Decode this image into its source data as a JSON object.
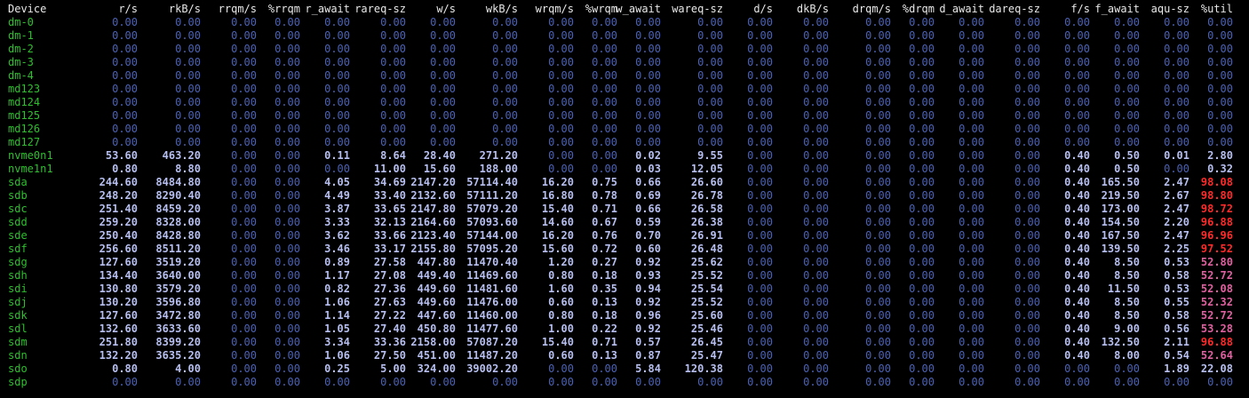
{
  "theme": {
    "background": "#000000",
    "header": "#e8e8e8",
    "device": "#2fbf2f",
    "zero_value": "#4c62b4",
    "nonzero_value": "#b7bff0",
    "util_high": "#ff2a2a",
    "util_mid": "#e060a0"
  },
  "headers": [
    "Device",
    "r/s",
    "rkB/s",
    "rrqm/s",
    "%rrqm",
    "r_await",
    "rareq-sz",
    "w/s",
    "wkB/s",
    "wrqm/s",
    "%wrqm",
    "w_await",
    "wareq-sz",
    "d/s",
    "dkB/s",
    "drqm/s",
    "%drqm",
    "d_await",
    "dareq-sz",
    "f/s",
    "f_await",
    "aqu-sz",
    "%util"
  ],
  "rows": [
    [
      "dm-0",
      "0.00",
      "0.00",
      "0.00",
      "0.00",
      "0.00",
      "0.00",
      "0.00",
      "0.00",
      "0.00",
      "0.00",
      "0.00",
      "0.00",
      "0.00",
      "0.00",
      "0.00",
      "0.00",
      "0.00",
      "0.00",
      "0.00",
      "0.00",
      "0.00",
      "0.00"
    ],
    [
      "dm-1",
      "0.00",
      "0.00",
      "0.00",
      "0.00",
      "0.00",
      "0.00",
      "0.00",
      "0.00",
      "0.00",
      "0.00",
      "0.00",
      "0.00",
      "0.00",
      "0.00",
      "0.00",
      "0.00",
      "0.00",
      "0.00",
      "0.00",
      "0.00",
      "0.00",
      "0.00"
    ],
    [
      "dm-2",
      "0.00",
      "0.00",
      "0.00",
      "0.00",
      "0.00",
      "0.00",
      "0.00",
      "0.00",
      "0.00",
      "0.00",
      "0.00",
      "0.00",
      "0.00",
      "0.00",
      "0.00",
      "0.00",
      "0.00",
      "0.00",
      "0.00",
      "0.00",
      "0.00",
      "0.00"
    ],
    [
      "dm-3",
      "0.00",
      "0.00",
      "0.00",
      "0.00",
      "0.00",
      "0.00",
      "0.00",
      "0.00",
      "0.00",
      "0.00",
      "0.00",
      "0.00",
      "0.00",
      "0.00",
      "0.00",
      "0.00",
      "0.00",
      "0.00",
      "0.00",
      "0.00",
      "0.00",
      "0.00"
    ],
    [
      "dm-4",
      "0.00",
      "0.00",
      "0.00",
      "0.00",
      "0.00",
      "0.00",
      "0.00",
      "0.00",
      "0.00",
      "0.00",
      "0.00",
      "0.00",
      "0.00",
      "0.00",
      "0.00",
      "0.00",
      "0.00",
      "0.00",
      "0.00",
      "0.00",
      "0.00",
      "0.00"
    ],
    [
      "md123",
      "0.00",
      "0.00",
      "0.00",
      "0.00",
      "0.00",
      "0.00",
      "0.00",
      "0.00",
      "0.00",
      "0.00",
      "0.00",
      "0.00",
      "0.00",
      "0.00",
      "0.00",
      "0.00",
      "0.00",
      "0.00",
      "0.00",
      "0.00",
      "0.00",
      "0.00"
    ],
    [
      "md124",
      "0.00",
      "0.00",
      "0.00",
      "0.00",
      "0.00",
      "0.00",
      "0.00",
      "0.00",
      "0.00",
      "0.00",
      "0.00",
      "0.00",
      "0.00",
      "0.00",
      "0.00",
      "0.00",
      "0.00",
      "0.00",
      "0.00",
      "0.00",
      "0.00",
      "0.00"
    ],
    [
      "md125",
      "0.00",
      "0.00",
      "0.00",
      "0.00",
      "0.00",
      "0.00",
      "0.00",
      "0.00",
      "0.00",
      "0.00",
      "0.00",
      "0.00",
      "0.00",
      "0.00",
      "0.00",
      "0.00",
      "0.00",
      "0.00",
      "0.00",
      "0.00",
      "0.00",
      "0.00"
    ],
    [
      "md126",
      "0.00",
      "0.00",
      "0.00",
      "0.00",
      "0.00",
      "0.00",
      "0.00",
      "0.00",
      "0.00",
      "0.00",
      "0.00",
      "0.00",
      "0.00",
      "0.00",
      "0.00",
      "0.00",
      "0.00",
      "0.00",
      "0.00",
      "0.00",
      "0.00",
      "0.00"
    ],
    [
      "md127",
      "0.00",
      "0.00",
      "0.00",
      "0.00",
      "0.00",
      "0.00",
      "0.00",
      "0.00",
      "0.00",
      "0.00",
      "0.00",
      "0.00",
      "0.00",
      "0.00",
      "0.00",
      "0.00",
      "0.00",
      "0.00",
      "0.00",
      "0.00",
      "0.00",
      "0.00"
    ],
    [
      "nvme0n1",
      "53.60",
      "463.20",
      "0.00",
      "0.00",
      "0.11",
      "8.64",
      "28.40",
      "271.20",
      "0.00",
      "0.00",
      "0.02",
      "9.55",
      "0.00",
      "0.00",
      "0.00",
      "0.00",
      "0.00",
      "0.00",
      "0.40",
      "0.50",
      "0.01",
      "2.80"
    ],
    [
      "nvme1n1",
      "0.80",
      "8.80",
      "0.00",
      "0.00",
      "0.00",
      "11.00",
      "15.60",
      "188.00",
      "0.00",
      "0.00",
      "0.03",
      "12.05",
      "0.00",
      "0.00",
      "0.00",
      "0.00",
      "0.00",
      "0.00",
      "0.40",
      "0.50",
      "0.00",
      "0.32"
    ],
    [
      "sda",
      "244.60",
      "8484.80",
      "0.00",
      "0.00",
      "4.05",
      "34.69",
      "2147.20",
      "57114.40",
      "16.20",
      "0.75",
      "0.66",
      "26.60",
      "0.00",
      "0.00",
      "0.00",
      "0.00",
      "0.00",
      "0.00",
      "0.40",
      "165.50",
      "2.47",
      "98.08"
    ],
    [
      "sdb",
      "248.20",
      "8290.40",
      "0.00",
      "0.00",
      "4.49",
      "33.40",
      "2132.60",
      "57111.20",
      "16.80",
      "0.78",
      "0.69",
      "26.78",
      "0.00",
      "0.00",
      "0.00",
      "0.00",
      "0.00",
      "0.00",
      "0.40",
      "219.50",
      "2.67",
      "98.80"
    ],
    [
      "sdc",
      "251.40",
      "8459.20",
      "0.00",
      "0.00",
      "3.87",
      "33.65",
      "2147.80",
      "57079.20",
      "15.40",
      "0.71",
      "0.66",
      "26.58",
      "0.00",
      "0.00",
      "0.00",
      "0.00",
      "0.00",
      "0.00",
      "0.40",
      "173.00",
      "2.47",
      "98.72"
    ],
    [
      "sdd",
      "259.20",
      "8328.00",
      "0.00",
      "0.00",
      "3.33",
      "32.13",
      "2164.60",
      "57093.60",
      "14.60",
      "0.67",
      "0.59",
      "26.38",
      "0.00",
      "0.00",
      "0.00",
      "0.00",
      "0.00",
      "0.00",
      "0.40",
      "154.50",
      "2.20",
      "96.88"
    ],
    [
      "sde",
      "250.40",
      "8428.80",
      "0.00",
      "0.00",
      "3.62",
      "33.66",
      "2123.40",
      "57144.00",
      "16.20",
      "0.76",
      "0.70",
      "26.91",
      "0.00",
      "0.00",
      "0.00",
      "0.00",
      "0.00",
      "0.00",
      "0.40",
      "167.50",
      "2.47",
      "96.96"
    ],
    [
      "sdf",
      "256.60",
      "8511.20",
      "0.00",
      "0.00",
      "3.46",
      "33.17",
      "2155.80",
      "57095.20",
      "15.60",
      "0.72",
      "0.60",
      "26.48",
      "0.00",
      "0.00",
      "0.00",
      "0.00",
      "0.00",
      "0.00",
      "0.40",
      "139.50",
      "2.25",
      "97.52"
    ],
    [
      "sdg",
      "127.60",
      "3519.20",
      "0.00",
      "0.00",
      "0.89",
      "27.58",
      "447.80",
      "11470.40",
      "1.20",
      "0.27",
      "0.92",
      "25.62",
      "0.00",
      "0.00",
      "0.00",
      "0.00",
      "0.00",
      "0.00",
      "0.40",
      "8.50",
      "0.53",
      "52.80"
    ],
    [
      "sdh",
      "134.40",
      "3640.00",
      "0.00",
      "0.00",
      "1.17",
      "27.08",
      "449.40",
      "11469.60",
      "0.80",
      "0.18",
      "0.93",
      "25.52",
      "0.00",
      "0.00",
      "0.00",
      "0.00",
      "0.00",
      "0.00",
      "0.40",
      "8.50",
      "0.58",
      "52.72"
    ],
    [
      "sdi",
      "130.80",
      "3579.20",
      "0.00",
      "0.00",
      "0.82",
      "27.36",
      "449.60",
      "11481.60",
      "1.60",
      "0.35",
      "0.94",
      "25.54",
      "0.00",
      "0.00",
      "0.00",
      "0.00",
      "0.00",
      "0.00",
      "0.40",
      "11.50",
      "0.53",
      "52.08"
    ],
    [
      "sdj",
      "130.20",
      "3596.80",
      "0.00",
      "0.00",
      "1.06",
      "27.63",
      "449.60",
      "11476.00",
      "0.60",
      "0.13",
      "0.92",
      "25.52",
      "0.00",
      "0.00",
      "0.00",
      "0.00",
      "0.00",
      "0.00",
      "0.40",
      "8.50",
      "0.55",
      "52.32"
    ],
    [
      "sdk",
      "127.60",
      "3472.80",
      "0.00",
      "0.00",
      "1.14",
      "27.22",
      "447.60",
      "11460.00",
      "0.80",
      "0.18",
      "0.96",
      "25.60",
      "0.00",
      "0.00",
      "0.00",
      "0.00",
      "0.00",
      "0.00",
      "0.40",
      "8.50",
      "0.58",
      "52.72"
    ],
    [
      "sdl",
      "132.60",
      "3633.60",
      "0.00",
      "0.00",
      "1.05",
      "27.40",
      "450.80",
      "11477.60",
      "1.00",
      "0.22",
      "0.92",
      "25.46",
      "0.00",
      "0.00",
      "0.00",
      "0.00",
      "0.00",
      "0.00",
      "0.40",
      "9.00",
      "0.56",
      "53.28"
    ],
    [
      "sdm",
      "251.80",
      "8399.20",
      "0.00",
      "0.00",
      "3.34",
      "33.36",
      "2158.00",
      "57087.20",
      "15.40",
      "0.71",
      "0.57",
      "26.45",
      "0.00",
      "0.00",
      "0.00",
      "0.00",
      "0.00",
      "0.00",
      "0.40",
      "132.50",
      "2.11",
      "96.88"
    ],
    [
      "sdn",
      "132.20",
      "3635.20",
      "0.00",
      "0.00",
      "1.06",
      "27.50",
      "451.00",
      "11487.20",
      "0.60",
      "0.13",
      "0.87",
      "25.47",
      "0.00",
      "0.00",
      "0.00",
      "0.00",
      "0.00",
      "0.00",
      "0.40",
      "8.00",
      "0.54",
      "52.64"
    ],
    [
      "sdo",
      "0.80",
      "4.00",
      "0.00",
      "0.00",
      "0.25",
      "5.00",
      "324.00",
      "39002.20",
      "0.00",
      "0.00",
      "5.84",
      "120.38",
      "0.00",
      "0.00",
      "0.00",
      "0.00",
      "0.00",
      "0.00",
      "0.00",
      "0.00",
      "1.89",
      "22.08"
    ],
    [
      "sdp",
      "0.00",
      "0.00",
      "0.00",
      "0.00",
      "0.00",
      "0.00",
      "0.00",
      "0.00",
      "0.00",
      "0.00",
      "0.00",
      "0.00",
      "0.00",
      "0.00",
      "0.00",
      "0.00",
      "0.00",
      "0.00",
      "0.00",
      "0.00",
      "0.00",
      "0.00"
    ]
  ]
}
